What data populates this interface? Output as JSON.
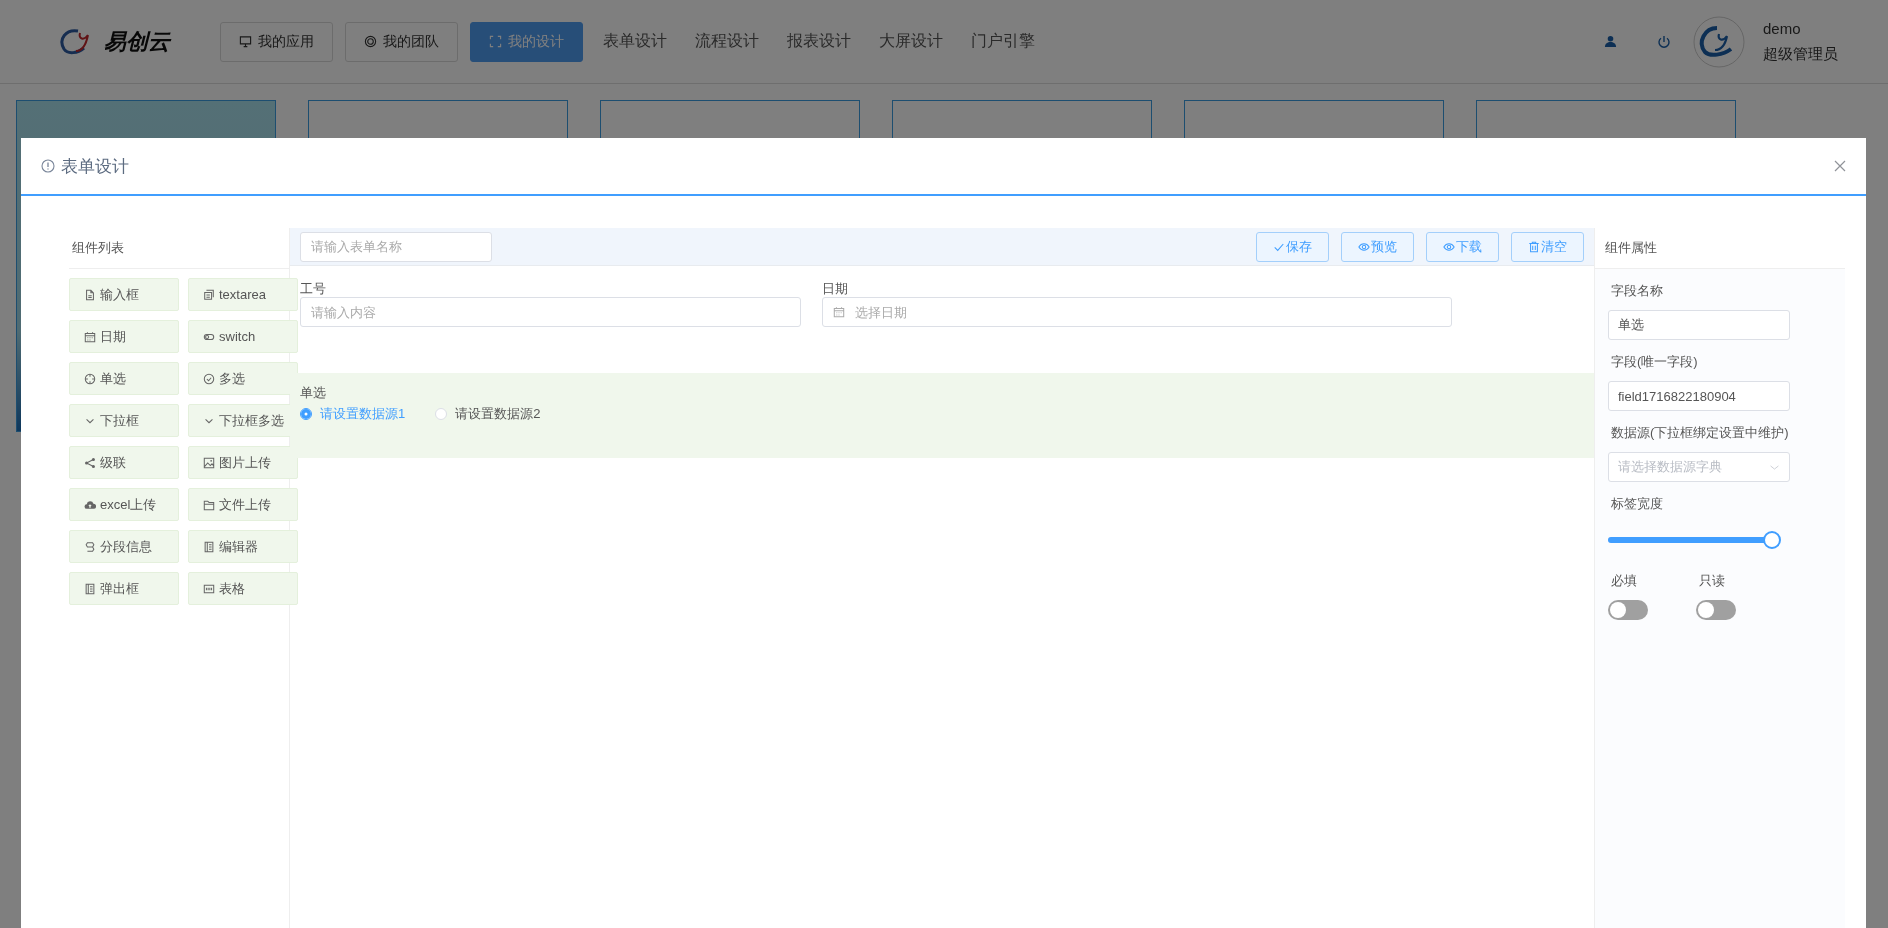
{
  "header": {
    "logo": "易创云",
    "nav": [
      {
        "label": "我的应用",
        "kind": "button",
        "selected": false
      },
      {
        "label": "我的团队",
        "kind": "button",
        "selected": false
      },
      {
        "label": "我的设计",
        "kind": "button",
        "selected": true
      },
      {
        "label": "表单设计",
        "kind": "link",
        "selected": false
      },
      {
        "label": "流程设计",
        "kind": "link",
        "selected": false
      },
      {
        "label": "报表设计",
        "kind": "link",
        "selected": false
      },
      {
        "label": "大屏设计",
        "kind": "link",
        "selected": false
      },
      {
        "label": "门户引擎",
        "kind": "link",
        "selected": false
      }
    ],
    "user": {
      "name": "demo",
      "role": "超级管理员"
    }
  },
  "modal": {
    "title": "表单设计",
    "palette": {
      "title": "组件列表",
      "items": [
        {
          "label": "输入框",
          "kind": "input"
        },
        {
          "label": "textarea",
          "kind": "textarea"
        },
        {
          "label": "日期",
          "kind": "date"
        },
        {
          "label": "switch",
          "kind": "switch"
        },
        {
          "label": "单选",
          "kind": "radio"
        },
        {
          "label": "多选",
          "kind": "checkbox"
        },
        {
          "label": "下拉框",
          "kind": "select"
        },
        {
          "label": "下拉框多选",
          "kind": "multiselect"
        },
        {
          "label": "级联",
          "kind": "cascader"
        },
        {
          "label": "图片上传",
          "kind": "image"
        },
        {
          "label": "excel上传",
          "kind": "excel"
        },
        {
          "label": "文件上传",
          "kind": "file"
        },
        {
          "label": "分段信息",
          "kind": "section"
        },
        {
          "label": "编辑器",
          "kind": "editor"
        },
        {
          "label": "弹出框",
          "kind": "dialog"
        },
        {
          "label": "表格",
          "kind": "table"
        }
      ]
    },
    "toolbar": {
      "placeholder": "请输入表单名称",
      "buttons": [
        {
          "label": "保存",
          "kind": "save"
        },
        {
          "label": "预览",
          "kind": "preview"
        },
        {
          "label": "下载",
          "kind": "download"
        },
        {
          "label": "清空",
          "kind": "clear"
        }
      ]
    },
    "fields": [
      {
        "label": "工号",
        "kind": "input",
        "placeholder": "请输入内容"
      },
      {
        "label": "日期",
        "kind": "date",
        "placeholder": "选择日期"
      }
    ],
    "radio_field": {
      "label": "单选",
      "selected": true,
      "options": [
        {
          "label": "请设置数据源1",
          "selected": true
        },
        {
          "label": "请设置数据源2",
          "selected": false
        }
      ]
    },
    "properties": {
      "title": "组件属性",
      "items": [
        {
          "kind": "text",
          "label": "字段名称",
          "value": "单选"
        },
        {
          "kind": "text",
          "label": "字段(唯一字段)",
          "value": "field1716822180904"
        },
        {
          "kind": "select",
          "label": "数据源(下拉框绑定设置中维护)",
          "placeholder": "请选择数据源字典"
        },
        {
          "kind": "slider",
          "label": "标签宽度",
          "level": 1
        }
      ],
      "switches": [
        {
          "label": "必填",
          "on": false
        },
        {
          "label": "只读",
          "on": false
        }
      ]
    }
  }
}
